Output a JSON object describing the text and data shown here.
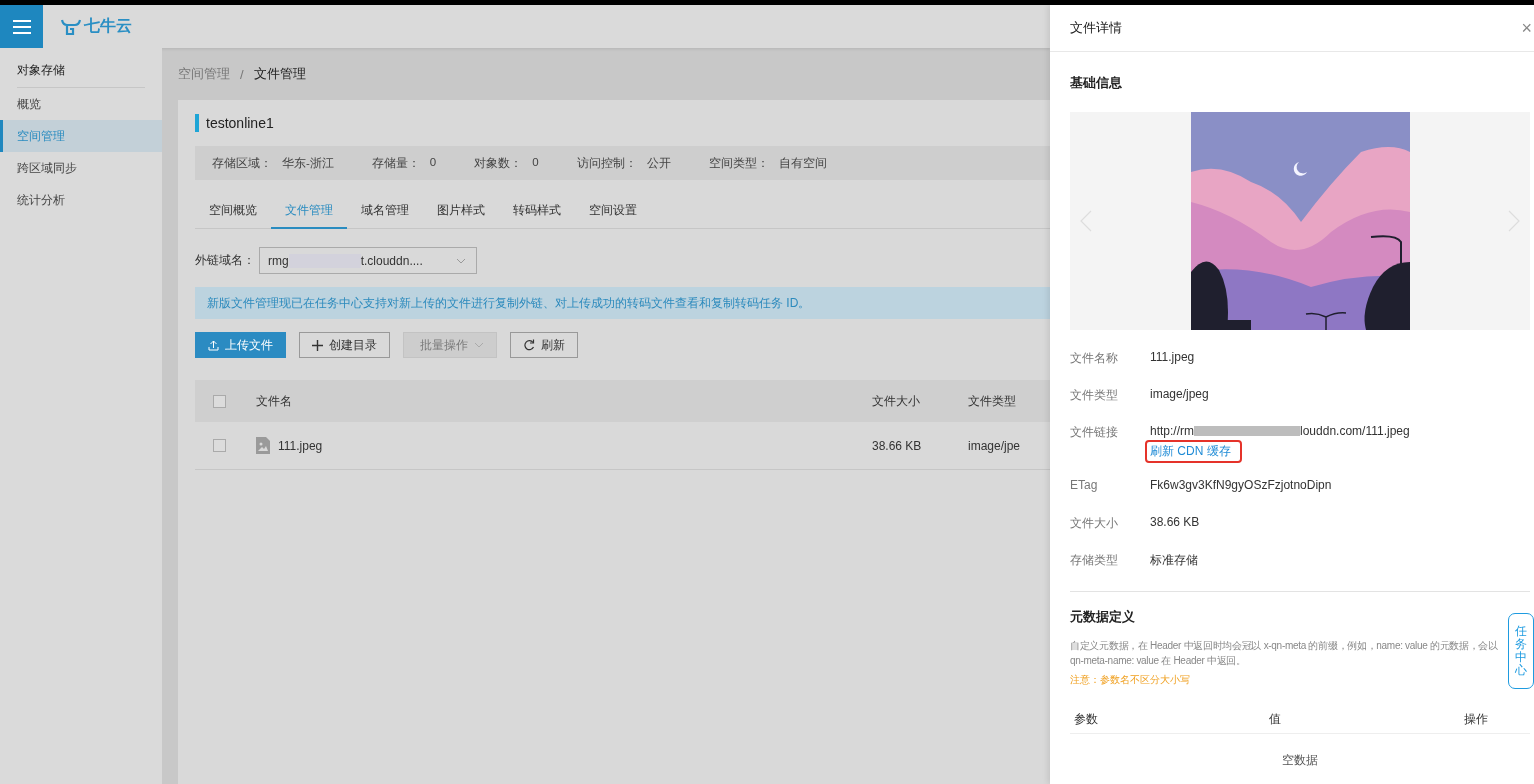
{
  "header": {
    "logo_text": "七牛云"
  },
  "sidebar": {
    "title": "对象存储",
    "items": [
      {
        "label": "概览",
        "selected": false
      },
      {
        "label": "空间管理",
        "selected": true
      },
      {
        "label": "跨区域同步",
        "selected": false
      },
      {
        "label": "统计分析",
        "selected": false
      }
    ]
  },
  "breadcrumb": [
    {
      "label": "空间管理",
      "current": false
    },
    {
      "label": "文件管理",
      "current": true
    }
  ],
  "breadcrumb_separator": "/",
  "bucket": {
    "name": "testonline1",
    "stats": [
      {
        "label": "存储区域：",
        "value": "华东-浙江"
      },
      {
        "label": "存储量：",
        "value": "0"
      },
      {
        "label": "对象数：",
        "value": "0"
      },
      {
        "label": "访问控制：",
        "value": "公开"
      },
      {
        "label": "空间类型：",
        "value": "自有空间"
      }
    ]
  },
  "tabs": [
    {
      "label": "空间概览",
      "selected": false
    },
    {
      "label": "文件管理",
      "selected": true
    },
    {
      "label": "域名管理",
      "selected": false
    },
    {
      "label": "图片样式",
      "selected": false
    },
    {
      "label": "转码样式",
      "selected": false
    },
    {
      "label": "空间设置",
      "selected": false
    }
  ],
  "domain_select": {
    "label": "外链域名：",
    "value_start": "rmg",
    "value_end": "t.clouddn...."
  },
  "notice": "新版文件管理现已在任务中心支持对新上传的文件进行复制外链、对上传成功的转码文件查看和复制转码任务 ID。",
  "toolbar": [
    {
      "kind": "upload",
      "label": "上传文件",
      "disabled": false
    },
    {
      "kind": "create",
      "label": "创建目录",
      "disabled": false
    },
    {
      "kind": "batch",
      "label": "批量操作",
      "disabled": true
    },
    {
      "kind": "refresh",
      "label": "刷新",
      "disabled": false
    }
  ],
  "table": {
    "columns": [
      "文件名",
      "文件大小",
      "文件类型"
    ],
    "rows": [
      {
        "checked": false,
        "name": "111.jpeg",
        "size": "38.66 KB",
        "type": "image/jpe"
      }
    ],
    "all_checked": false
  },
  "panel": {
    "title": "文件详情",
    "close": "×",
    "basic_title": "基础信息",
    "preview": {
      "kind": "picture"
    },
    "fields": [
      {
        "kind": "text",
        "label": "文件名称",
        "value": "111.jpeg"
      },
      {
        "kind": "text",
        "label": "文件类型",
        "value": "image/jpeg"
      },
      {
        "kind": "link",
        "label": "文件链接",
        "value_start": "http://rm",
        "value_end": "louddn.com/111.jpeg",
        "action": "刷新 CDN 缓存"
      },
      {
        "kind": "text",
        "label": "ETag",
        "value": "Fk6w3gv3KfN9gyOSzFzjotnoDipn"
      },
      {
        "kind": "text",
        "label": "文件大小",
        "value": "38.66 KB"
      },
      {
        "kind": "text",
        "label": "存储类型",
        "value": "标准存储"
      }
    ],
    "meta_title": "元数据定义",
    "meta_description": [
      "自定义元数据，在 Header 中返回时均会冠以 x-qn-meta 的前缀，例如，name: value 的元数据，会以",
      "qn-meta-name: value 在 Header 中返回。"
    ],
    "meta_note": "注意：参数名不区分大小写",
    "meta_columns": [
      "参数",
      "值",
      "操作"
    ],
    "meta_empty": "空数据"
  },
  "task_center": "任务中心"
}
